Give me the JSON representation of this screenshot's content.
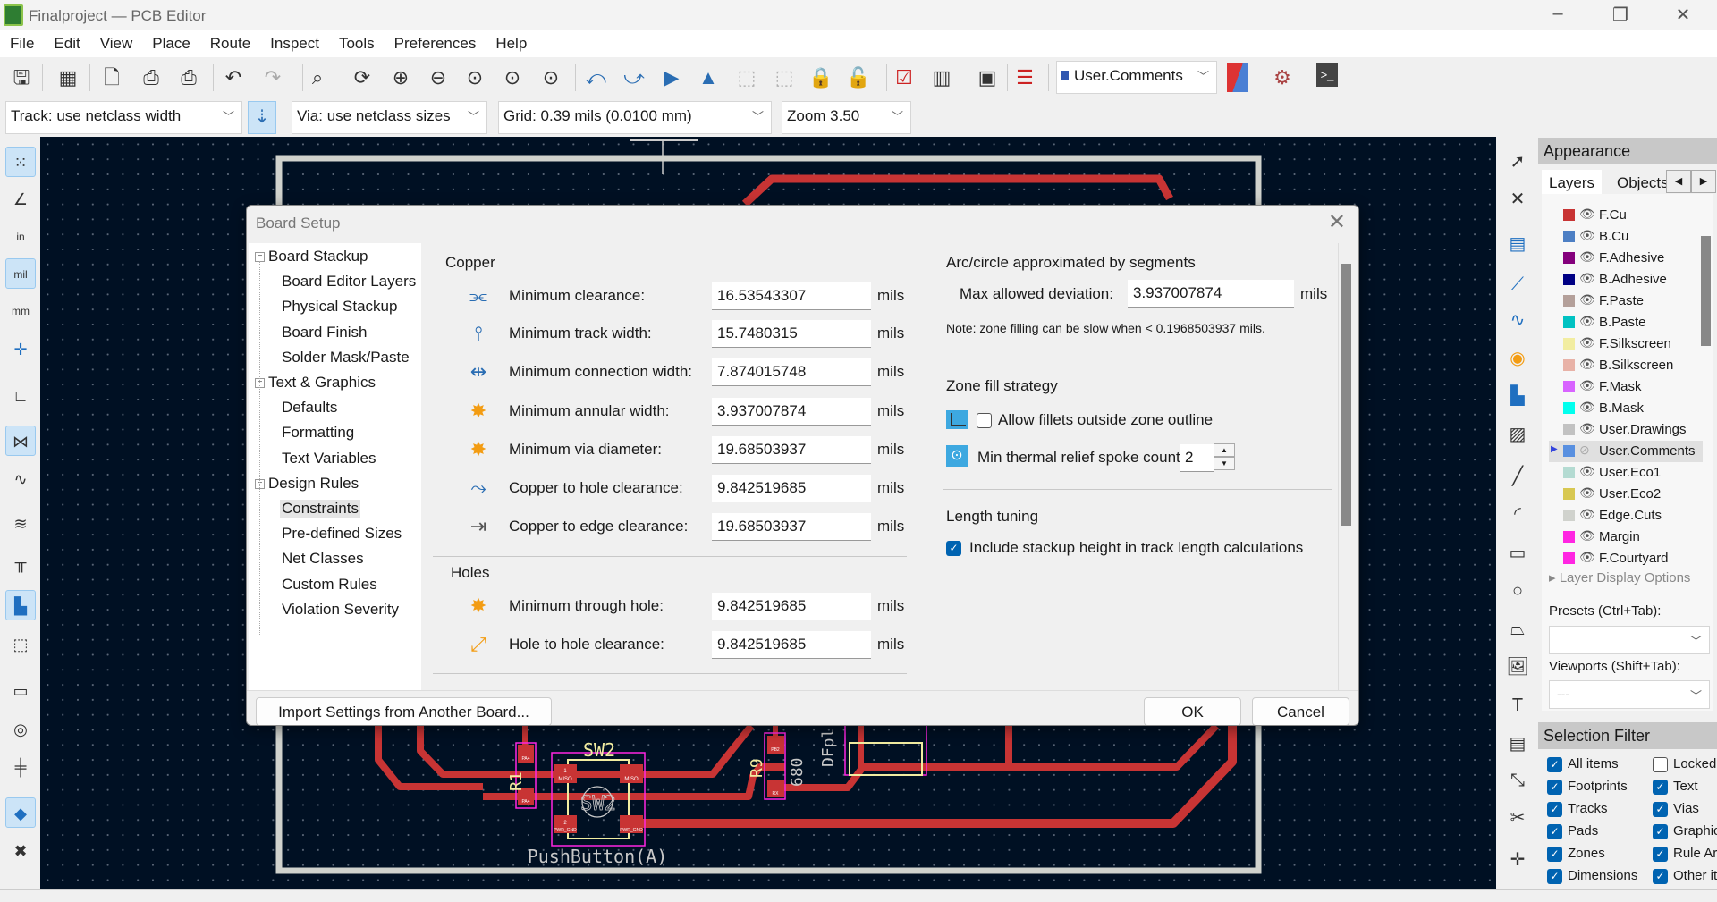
{
  "window": {
    "title": "Finalproject — PCB Editor",
    "minimize": "–",
    "restore": "❐",
    "close": "✕"
  },
  "menu": [
    "File",
    "Edit",
    "View",
    "Place",
    "Route",
    "Inspect",
    "Tools",
    "Preferences",
    "Help"
  ],
  "toolbar": {
    "icons": [
      "save",
      "board-setup",
      "new-page",
      "print",
      "plot",
      "undo",
      "redo",
      "find",
      "refresh",
      "zoom-in",
      "zoom-out",
      "zoom-fit",
      "zoom-objects",
      "zoom-selection",
      "rotate-ccw",
      "rotate-cw",
      "flip",
      "mirror",
      "group",
      "ungroup",
      "lock",
      "unlock",
      "drc",
      "net-inspector",
      "footprint-editor",
      "footprint-checker"
    ],
    "layer_select": "User.Comments",
    "track": "Track: use netclass width",
    "via": "Via: use netclass sizes",
    "grid": "Grid: 0.39 mils (0.0100 mm)",
    "zoom": "Zoom 3.50"
  },
  "left_toolbar": [
    "grid",
    "polar-coords",
    "inches",
    "mils",
    "millimeters",
    "cursor",
    "angle",
    "ratsnest",
    "curved-ratsnest",
    "high-contrast",
    "net-colors",
    "zones-filled",
    "zones-outline",
    "pads-sketch",
    "vias-sketch",
    "tracks-sketch",
    "layers-manager",
    "properties"
  ],
  "right_toolbar": [
    "select",
    "route-local-ratsnest",
    "footprint",
    "route-track",
    "tune-length",
    "via",
    "zone",
    "rule-area",
    "line",
    "arc",
    "rectangle",
    "circle",
    "polygon",
    "image",
    "text",
    "textbox",
    "dimension",
    "delete",
    "origin"
  ],
  "pcb": {
    "silk": [
      "SW2",
      "PushButton(A)",
      "R1",
      "R9",
      "680",
      "DFpl",
      "SW2"
    ],
    "pads": [
      "1",
      "MISO",
      "2",
      "PWR_GND",
      "PA4",
      "PB2",
      "RX"
    ]
  },
  "dialog": {
    "title": "Board Setup",
    "tree": [
      {
        "label": "Board Stackup",
        "level": 0
      },
      {
        "label": "Board Editor Layers",
        "level": 1
      },
      {
        "label": "Physical Stackup",
        "level": 1
      },
      {
        "label": "Board Finish",
        "level": 1
      },
      {
        "label": "Solder Mask/Paste",
        "level": 1
      },
      {
        "label": "Text & Graphics",
        "level": 0
      },
      {
        "label": "Defaults",
        "level": 1
      },
      {
        "label": "Formatting",
        "level": 1
      },
      {
        "label": "Text Variables",
        "level": 1
      },
      {
        "label": "Design Rules",
        "level": 0
      },
      {
        "label": "Constraints",
        "level": 1,
        "selected": true
      },
      {
        "label": "Pre-defined Sizes",
        "level": 1
      },
      {
        "label": "Net Classes",
        "level": 1
      },
      {
        "label": "Custom Rules",
        "level": 1
      },
      {
        "label": "Violation Severity",
        "level": 1
      }
    ],
    "copper_title": "Copper",
    "copper": [
      {
        "label": "Minimum clearance:",
        "value": "16.53543307",
        "unit": "mils"
      },
      {
        "label": "Minimum track width:",
        "value": "15.7480315",
        "unit": "mils"
      },
      {
        "label": "Minimum connection width:",
        "value": "7.874015748",
        "unit": "mils"
      },
      {
        "label": "Minimum annular width:",
        "value": "3.937007874",
        "unit": "mils"
      },
      {
        "label": "Minimum via diameter:",
        "value": "19.68503937",
        "unit": "mils"
      },
      {
        "label": "Copper to hole clearance:",
        "value": "9.842519685",
        "unit": "mils"
      },
      {
        "label": "Copper to edge clearance:",
        "value": "19.68503937",
        "unit": "mils"
      }
    ],
    "holes_title": "Holes",
    "holes": [
      {
        "label": "Minimum through hole:",
        "value": "9.842519685",
        "unit": "mils"
      },
      {
        "label": "Hole to hole clearance:",
        "value": "9.842519685",
        "unit": "mils"
      }
    ],
    "arc_title": "Arc/circle approximated by segments",
    "max_dev_label": "Max allowed deviation:",
    "max_dev_value": "3.937007874",
    "max_dev_unit": "mils",
    "note": "Note: zone filling can be slow when < 0.1968503937 mils.",
    "zone_title": "Zone fill strategy",
    "fillets_label": "Allow fillets outside zone outline",
    "fillets_checked": false,
    "spoke_label": "Min thermal relief spoke count:",
    "spoke_value": "2",
    "length_title": "Length tuning",
    "stackup_label": "Include stackup height in track length calculations",
    "stackup_checked": true,
    "import_button": "Import Settings from Another Board...",
    "ok": "OK",
    "cancel": "Cancel"
  },
  "appearance": {
    "title": "Appearance",
    "tabs": [
      "Layers",
      "Objects"
    ],
    "layers": [
      {
        "name": "F.Cu",
        "color": "#c83434"
      },
      {
        "name": "B.Cu",
        "color": "#4d7fc4"
      },
      {
        "name": "F.Adhesive",
        "color": "#84007c"
      },
      {
        "name": "B.Adhesive",
        "color": "#000084"
      },
      {
        "name": "F.Paste",
        "color": "#b4a09a"
      },
      {
        "name": "B.Paste",
        "color": "#00c2c2"
      },
      {
        "name": "F.Silkscreen",
        "color": "#f2eda1"
      },
      {
        "name": "B.Silkscreen",
        "color": "#e8b2a7"
      },
      {
        "name": "F.Mask",
        "color": "#d864ff"
      },
      {
        "name": "B.Mask",
        "color": "#02ffee"
      },
      {
        "name": "User.Drawings",
        "color": "#c2c2c2"
      },
      {
        "name": "User.Comments",
        "color": "#5990e0",
        "active": true,
        "hidden": true
      },
      {
        "name": "User.Eco1",
        "color": "#b4dbd2"
      },
      {
        "name": "User.Eco2",
        "color": "#d8c852"
      },
      {
        "name": "Edge.Cuts",
        "color": "#d0d2cd"
      },
      {
        "name": "Margin",
        "color": "#ff26e2"
      },
      {
        "name": "F.Courtyard",
        "color": "#ff26e2"
      }
    ],
    "layer_display_options": "Layer Display Options",
    "presets_label": "Presets (Ctrl+Tab):",
    "presets_value": "",
    "viewports_label": "Viewports (Shift+Tab):",
    "viewports_value": "---",
    "selection_filter_title": "Selection Filter",
    "filters": [
      {
        "label": "All items",
        "checked": true
      },
      {
        "label": "Locked items",
        "checked": false
      },
      {
        "label": "Footprints",
        "checked": true
      },
      {
        "label": "Text",
        "checked": true
      },
      {
        "label": "Tracks",
        "checked": true
      },
      {
        "label": "Vias",
        "checked": true
      },
      {
        "label": "Pads",
        "checked": true
      },
      {
        "label": "Graphics",
        "checked": true
      },
      {
        "label": "Zones",
        "checked": true
      },
      {
        "label": "Rule Areas",
        "checked": true
      },
      {
        "label": "Dimensions",
        "checked": true
      },
      {
        "label": "Other items",
        "checked": true
      }
    ]
  },
  "colors": {
    "canvas": "#001023",
    "copper": "#c83434",
    "edge": "#d0d2cd",
    "courtyard": "#ff26e2",
    "silk": "#f2eda1",
    "accent": "#0063b1"
  }
}
